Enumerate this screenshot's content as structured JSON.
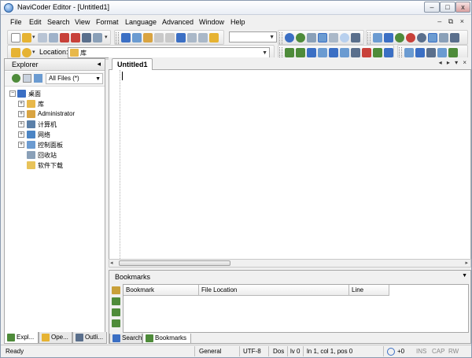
{
  "window": {
    "title": "NaviCoder Editor - [Untitled1]",
    "minimize_glyph": "–",
    "maximize_glyph": "□",
    "close_glyph": "x"
  },
  "menubar": {
    "items": [
      "File",
      "Edit",
      "Search",
      "View",
      "Format",
      "Language",
      "Advanced",
      "Window",
      "Help"
    ],
    "mdi_controls": "– ⧉ ×"
  },
  "location": {
    "label": "Location:",
    "value": "库"
  },
  "explorer": {
    "title": "Explorer",
    "close_glyph": "◂",
    "filter": "All Files (*)",
    "tree": [
      {
        "label": "桌面",
        "level": 0,
        "expander": "−",
        "icon": "desktop-icon",
        "color": "#3b6fc4"
      },
      {
        "label": "库",
        "level": 1,
        "expander": "+",
        "icon": "library-folder-icon",
        "color": "#e8b84a"
      },
      {
        "label": "Administrator",
        "level": 1,
        "expander": "+",
        "icon": "user-folder-icon",
        "color": "#d9a441"
      },
      {
        "label": "计算机",
        "level": 1,
        "expander": "+",
        "icon": "computer-icon",
        "color": "#5a7fa8"
      },
      {
        "label": "网络",
        "level": 1,
        "expander": "+",
        "icon": "network-icon",
        "color": "#4a84c4"
      },
      {
        "label": "控制面板",
        "level": 1,
        "expander": "+",
        "icon": "control-panel-icon",
        "color": "#6b9bd1"
      },
      {
        "label": "回收站",
        "level": 1,
        "expander": "",
        "icon": "recycle-bin-icon",
        "color": "#8aa0b8"
      },
      {
        "label": "软件下载",
        "level": 1,
        "expander": "",
        "icon": "folder-icon",
        "color": "#e8c35a"
      }
    ],
    "tabs": [
      "Expl...",
      "Ope...",
      "Outli..."
    ]
  },
  "editor": {
    "tab_label": "Untitled1",
    "tab_nav": "◂ ▸ ▾ ×"
  },
  "bookmarks": {
    "title": "Bookmarks",
    "columns": [
      "Bookmark",
      "File Location",
      "Line"
    ],
    "tabs": [
      "Search",
      "Bookmarks"
    ]
  },
  "statusbar": {
    "ready": "Ready",
    "mode": "General",
    "encoding": "UTF-8",
    "line_ending": "Dos",
    "lv": "lv 0",
    "position": "ln 1, col 1, pos 0",
    "zoom": "+0",
    "ins": "INS",
    "cap": "CAP",
    "rw": "RW"
  },
  "colors": {
    "accent": "#3a7bc8",
    "toolbar_icon_blue": "#3b6fc4",
    "toolbar_icon_red": "#c8413a",
    "toolbar_icon_green": "#4e8b3a",
    "toolbar_icon_yellow": "#e6b333"
  }
}
